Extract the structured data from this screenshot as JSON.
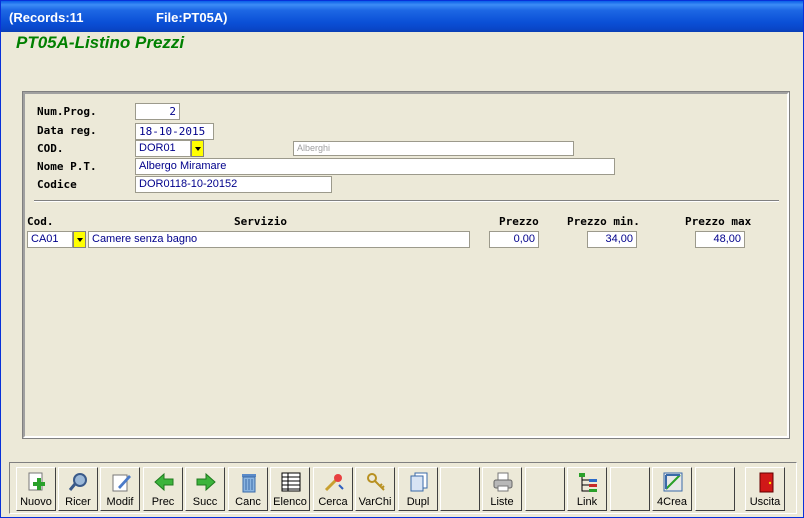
{
  "window": {
    "records": "(Records:11",
    "file": "File:PT05A)"
  },
  "form_title": "PT05A-Listino Prezzi",
  "header": {
    "num_prog": {
      "label": "Num.Prog.",
      "value": "2"
    },
    "data_reg": {
      "label": "Data reg.",
      "value": "18-10-2015"
    },
    "cod": {
      "label": "COD.",
      "value": "DOR01",
      "description": "Alberghi"
    },
    "nome_pt": {
      "label": "Nome P.T.",
      "value": "Albergo Miramare"
    },
    "codice": {
      "label": "Codice",
      "value": "DOR0118-10-20152"
    }
  },
  "detail": {
    "headers": {
      "cod": "Cod.",
      "servizio": "Servizio",
      "prezzo": "Prezzo",
      "prezzo_min": "Prezzo min.",
      "prezzo_max": "Prezzo max"
    },
    "rows": [
      {
        "cod": "CA01",
        "servizio": "Camere senza bagno",
        "prezzo": "0,00",
        "prezzo_min": "34,00",
        "prezzo_max": "48,00"
      }
    ]
  },
  "toolbar": [
    {
      "label": "Nuovo",
      "icon": "new-icon"
    },
    {
      "label": "Ricer",
      "icon": "search-icon"
    },
    {
      "label": "Modif",
      "icon": "edit-icon"
    },
    {
      "label": "Prec",
      "icon": "arrow-left-icon"
    },
    {
      "label": "Succ",
      "icon": "arrow-right-icon"
    },
    {
      "label": "Canc",
      "icon": "trash-icon"
    },
    {
      "label": "Elenco",
      "icon": "list-icon"
    },
    {
      "label": "Cerca",
      "icon": "find-icon"
    },
    {
      "label": "VarChi",
      "icon": "keys-icon"
    },
    {
      "label": "Dupl",
      "icon": "duplicate-icon"
    },
    {
      "label": "",
      "icon": ""
    },
    {
      "label": "Liste",
      "icon": "printer-icon"
    },
    {
      "label": "",
      "icon": ""
    },
    {
      "label": "Link",
      "icon": "link-icon"
    },
    {
      "label": "",
      "icon": ""
    },
    {
      "label": "4Crea",
      "icon": "create-icon"
    },
    {
      "label": "",
      "icon": ""
    },
    {
      "label": "Uscita",
      "icon": "exit-door-icon"
    }
  ]
}
